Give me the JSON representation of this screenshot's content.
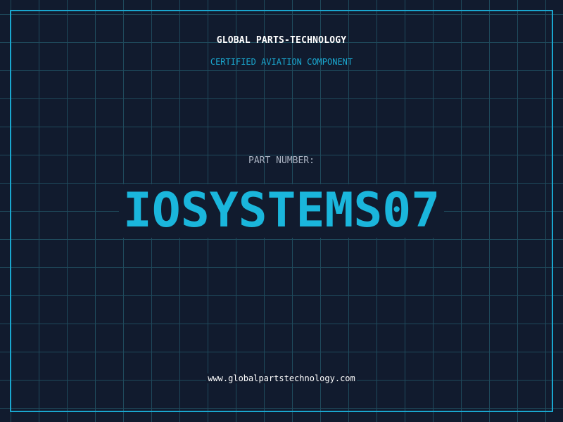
{
  "header": {
    "brand": "GLOBAL PARTS-TECHNOLOGY",
    "subtitle": "CERTIFIED AVIATION COMPONENT"
  },
  "part": {
    "label": "PART NUMBER:",
    "number": "IOSYSTEMS07"
  },
  "footer": {
    "website": "www.globalpartstechnology.com"
  },
  "colors": {
    "background": "#111b2e",
    "grid": "#1f4a5c",
    "accent": "#1aa7cf",
    "part_number": "#1ab6dc",
    "label": "#aab3c2",
    "text": "#ffffff"
  }
}
